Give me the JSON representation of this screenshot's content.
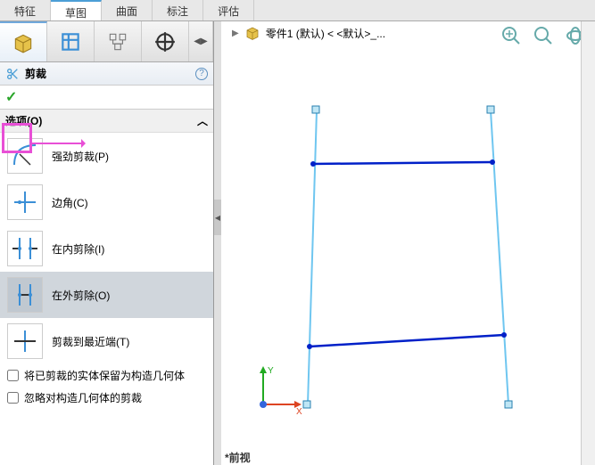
{
  "tabs": {
    "features": "特征",
    "sketch": "草图",
    "surface": "曲面",
    "annotate": "标注",
    "evaluate": "评估"
  },
  "command": {
    "name": "剪裁",
    "help": "?"
  },
  "section": {
    "options_label": "选项(O)",
    "chevron": "︿"
  },
  "options": {
    "power": "强劲剪裁(P)",
    "corner": "边角(C)",
    "trim_inside": "在内剪除(I)",
    "trim_outside": "在外剪除(O)",
    "trim_closest": "剪裁到最近端(T)"
  },
  "checkboxes": {
    "keep_construction": "将已剪裁的实体保留为构造几何体",
    "ignore_construction": "忽略对构造几何体的剪裁"
  },
  "doc": {
    "name": "零件1 (默认) < <默认>_..."
  },
  "triad": {
    "x": "X",
    "y": "Y"
  },
  "view": {
    "label": "*前视"
  }
}
